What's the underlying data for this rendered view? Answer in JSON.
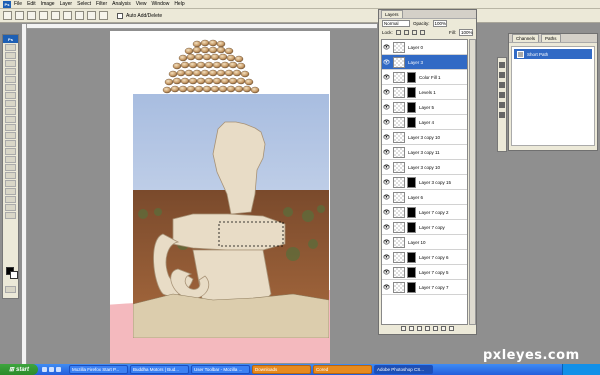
{
  "menubar": {
    "app_icon": "ps-icon",
    "items": [
      "File",
      "Edit",
      "Image",
      "Layer",
      "Select",
      "Filter",
      "Analysis",
      "View",
      "Window",
      "Help"
    ]
  },
  "options": {
    "auto_add_delete_label": "Auto Add/Delete"
  },
  "toolbox": {
    "ps_label": "Ps"
  },
  "layers_panel": {
    "tab_label": "Layers",
    "blend_mode": "Normal",
    "opacity_label": "Opacity:",
    "opacity_value": "100%",
    "lock_label": "Lock:",
    "fill_label": "Fill:",
    "fill_value": "100%",
    "layers": [
      {
        "name": "Layer 0",
        "active": false,
        "mask": false
      },
      {
        "name": "Layer 3",
        "active": true,
        "mask": false
      },
      {
        "name": "Color Fill 1",
        "active": false,
        "mask": true
      },
      {
        "name": "Levels 1",
        "active": false,
        "mask": true
      },
      {
        "name": "Layer 5",
        "active": false,
        "mask": true
      },
      {
        "name": "Layer 4",
        "active": false,
        "mask": true
      },
      {
        "name": "Layer 3 copy 10",
        "active": false,
        "mask": false
      },
      {
        "name": "Layer 3 copy 11",
        "active": false,
        "mask": false
      },
      {
        "name": "Layer 3 copy 10",
        "active": false,
        "mask": false
      },
      {
        "name": "Layer 3 copy 15",
        "active": false,
        "mask": true
      },
      {
        "name": "Layer 6",
        "active": false,
        "mask": false
      },
      {
        "name": "Layer 7 copy 2",
        "active": false,
        "mask": true
      },
      {
        "name": "Layer 7 copy",
        "active": false,
        "mask": true
      },
      {
        "name": "Layer 10",
        "active": false,
        "mask": false
      },
      {
        "name": "Layer 7 copy 6",
        "active": false,
        "mask": true
      },
      {
        "name": "Layer 7 copy 5",
        "active": false,
        "mask": true
      },
      {
        "name": "Layer 7 copy 7",
        "active": false,
        "mask": true
      }
    ]
  },
  "channels_panel": {
    "tabs": [
      "Channels",
      "Paths"
    ],
    "path_name": "Short Path"
  },
  "taskbar": {
    "start_label": "start",
    "tasks": [
      "Mozilla Firefox Start P...",
      "Buddha Motors | Bud...",
      "User Toolbar - Mozilla ...",
      "Downloads",
      "Cored",
      "Adobe Photoshop CS..."
    ]
  },
  "watermark": "pxleyes.com"
}
